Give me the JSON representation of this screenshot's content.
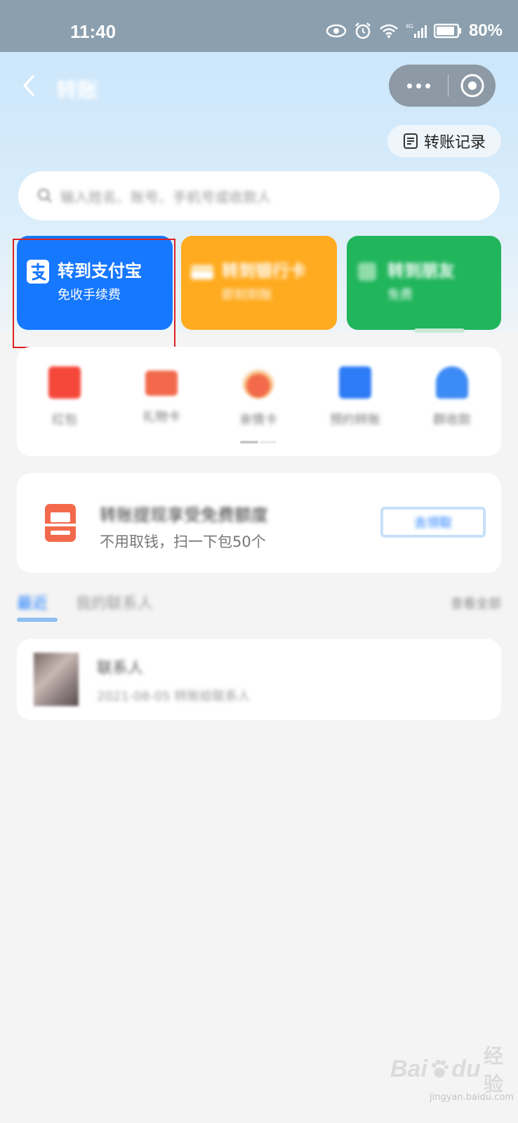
{
  "status_bar": {
    "time": "11:40",
    "battery": "80%",
    "icons": [
      "eye-icon",
      "alarm-icon",
      "wifi-icon",
      "signal-4g-icon",
      "battery-icon"
    ]
  },
  "nav": {
    "back_icon": "chevron-left-icon",
    "title": "转账",
    "more_icon": "more-dots-icon",
    "close_icon": "target-close-icon"
  },
  "record": {
    "label": "转账记录",
    "icon": "list-doc-icon"
  },
  "search": {
    "placeholder": "输入姓名、账号、手机号或收款人",
    "icon": "search-icon"
  },
  "cards": [
    {
      "title": "转到支付宝",
      "subtitle": "免收手续费",
      "color": "#1677ff",
      "icon": "alipay-icon"
    },
    {
      "title": "转到银行卡",
      "subtitle": "即刻到账",
      "color": "#ffab1f",
      "icon": "bank-card-icon"
    },
    {
      "title": "转到朋友",
      "subtitle": "免费",
      "color": "#21b55c",
      "icon": "friend-icon"
    }
  ],
  "grid_items": [
    {
      "label": "红包",
      "color": "#f5483b",
      "icon": "red-packet-icon"
    },
    {
      "label": "礼物卡",
      "color": "#f26a4b",
      "icon": "gift-card-icon"
    },
    {
      "label": "亲情卡",
      "color": "#f08a3a",
      "icon": "family-card-icon"
    },
    {
      "label": "预约转账",
      "color": "#2e7bf6",
      "icon": "calendar-icon"
    },
    {
      "label": "群收款",
      "color": "#3d8bf5",
      "icon": "group-collect-icon"
    }
  ],
  "promo": {
    "title": "转账提现享受免费额度",
    "subtitle": "不用取钱，扫一下包50个",
    "button": "去领取",
    "icon": "red-envelope-icon"
  },
  "tabs": {
    "recent": "最近",
    "contacts": "我的联系人",
    "right": "查看全部"
  },
  "contact": {
    "name": "联系人",
    "meta": "2021-08-05 转账给联系人"
  },
  "watermark": {
    "brand": "Bai",
    "brand2": "du",
    "cn": "经验",
    "url": "jingyan.baidu.com"
  }
}
